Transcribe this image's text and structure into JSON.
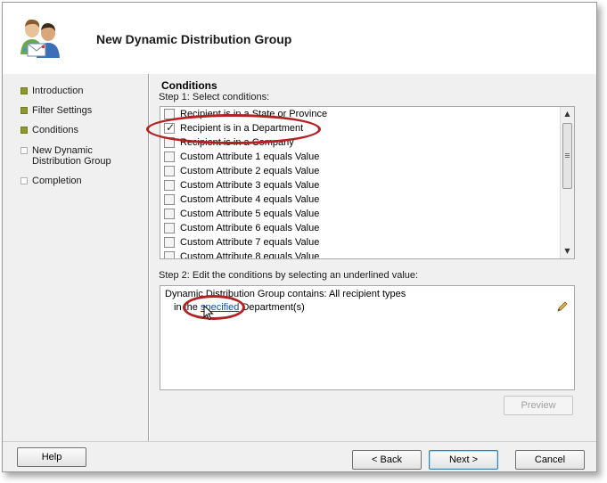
{
  "window": {
    "title": "New Dynamic Distribution Group"
  },
  "nav": {
    "items": [
      {
        "label": "Introduction",
        "state": "done"
      },
      {
        "label": "Filter Settings",
        "state": "done"
      },
      {
        "label": "Conditions",
        "state": "done"
      },
      {
        "label": "New Dynamic Distribution Group",
        "state": "todo"
      },
      {
        "label": "Completion",
        "state": "todo"
      }
    ]
  },
  "main": {
    "section_title": "Conditions",
    "step1_label": "Step 1: Select conditions:",
    "conditions": [
      {
        "label": "Recipient is in a State or Province",
        "checked": false
      },
      {
        "label": "Recipient is in a Department",
        "checked": true
      },
      {
        "label": "Recipient is in a Company",
        "checked": false
      },
      {
        "label": "Custom Attribute 1 equals Value",
        "checked": false
      },
      {
        "label": "Custom Attribute 2 equals Value",
        "checked": false
      },
      {
        "label": "Custom Attribute 3 equals Value",
        "checked": false
      },
      {
        "label": "Custom Attribute 4 equals Value",
        "checked": false
      },
      {
        "label": "Custom Attribute 5 equals Value",
        "checked": false
      },
      {
        "label": "Custom Attribute 6 equals Value",
        "checked": false
      },
      {
        "label": "Custom Attribute 7 equals Value",
        "checked": false
      },
      {
        "label": "Custom Attribute 8 equals Value",
        "checked": false
      }
    ],
    "step2_label": "Step 2: Edit the conditions by selecting an underlined value:",
    "description": {
      "line1": "Dynamic Distribution Group contains: All recipient types",
      "line2_prefix": "in the ",
      "line2_link": "specified",
      "line2_suffix": " Department(s)"
    },
    "preview_label": "Preview"
  },
  "footer": {
    "help_label": "Help",
    "back_label": "< Back",
    "next_label": "Next >",
    "cancel_label": "Cancel"
  },
  "icons": {
    "wizard": "users-group-icon",
    "edit": "pencil-icon",
    "scroll_up": "scroll-up-icon",
    "scroll_down": "scroll-down-icon"
  },
  "colors": {
    "nav_done": "#8c9a2a",
    "link": "#0b4fa8",
    "highlight_ellipse": "#b32222"
  }
}
